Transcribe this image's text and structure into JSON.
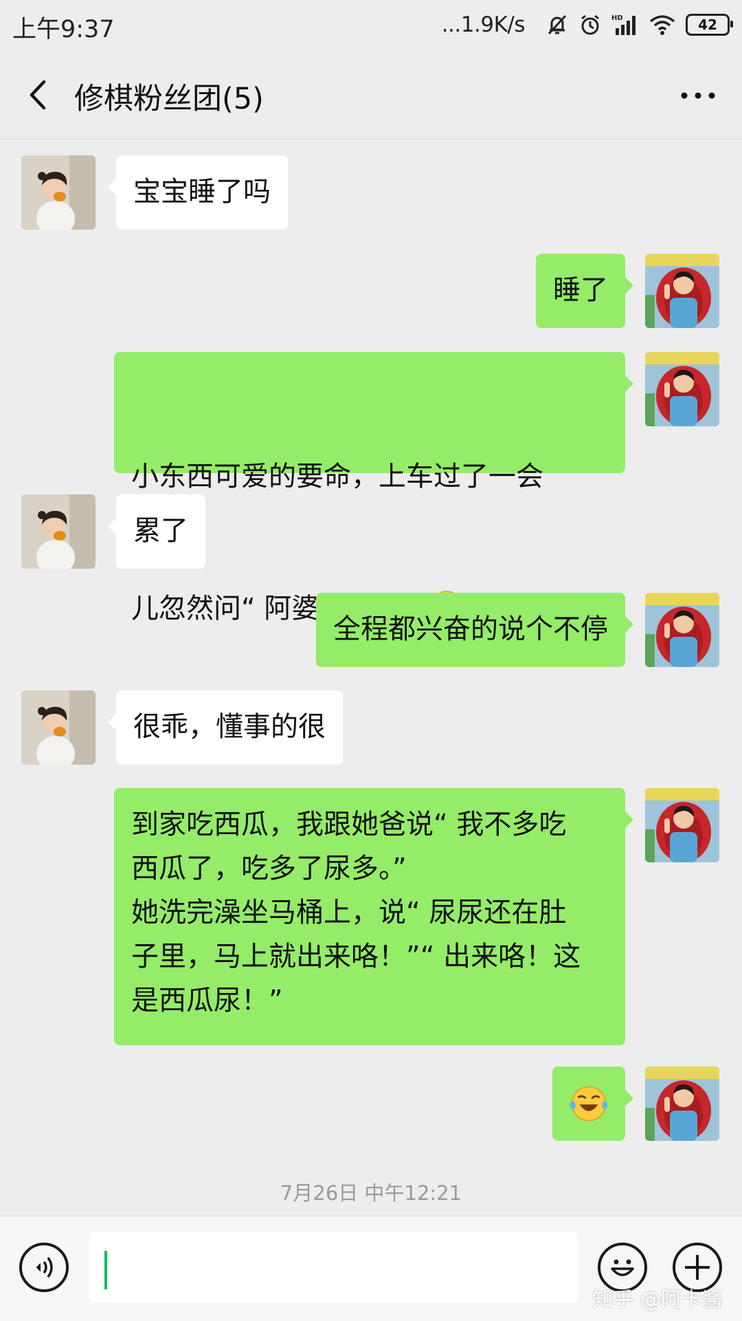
{
  "status_bar": {
    "time": "上午9:37",
    "net_speed": "...1.9K/s",
    "battery": "42",
    "icons": [
      "mute-bell-icon",
      "alarm-icon",
      "hd-signal-icon",
      "wifi-icon",
      "battery-icon"
    ]
  },
  "header": {
    "title": "修棋粉丝团(5)",
    "back_icon": "chevron-left-icon",
    "more_icon": "more-dots-icon"
  },
  "messages": [
    {
      "side": "in",
      "text": "宝宝睡了吗"
    },
    {
      "side": "out",
      "text": "睡了"
    },
    {
      "side": "out",
      "text_line1": "小东西可爱的要命，上车过了一会",
      "text_line2": "儿忽然问“ 阿婆去哪里了",
      "text_after_emoji": "”",
      "emoji": "laugh-cry-emoji"
    },
    {
      "side": "in",
      "text": "累了"
    },
    {
      "side": "out",
      "text": "全程都兴奋的说个不停"
    },
    {
      "side": "in",
      "text": "很乖，懂事的很"
    },
    {
      "side": "out",
      "text": "到家吃西瓜，我跟她爸说“ 我不多吃\n西瓜了，吃多了尿多。”\n她洗完澡坐马桶上，说“ 尿尿还在肚\n子里，马上就出来咯！”“ 出来咯！这\n是西瓜尿！”"
    },
    {
      "side": "out",
      "text": "",
      "emoji": "laugh-cry-emoji"
    }
  ],
  "timestamp": "7月26日 中午12:21",
  "input_bar": {
    "voice_icon": "voice-icon",
    "emoji_icon": "smiley-icon",
    "plus_icon": "plus-icon",
    "watermark": "知乎 @阿卡酱"
  },
  "colors": {
    "background": "#ededed",
    "outgoing_bubble": "#95ec69",
    "incoming_bubble": "#ffffff",
    "caret": "#07c160"
  }
}
